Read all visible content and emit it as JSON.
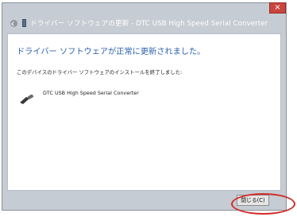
{
  "window": {
    "title": "ドライバー ソフトウェアの更新 - DTC USB High Speed Serial Converter",
    "close_glyph": "×"
  },
  "content": {
    "heading": "ドライバー ソフトウェアが正常に更新されました。",
    "description": "このデバイスのドライバー ソフトウェアのインストールを終了しました:",
    "device": {
      "icon": "usb-connector-icon",
      "name": "DTC USB High Speed Serial Converter"
    }
  },
  "footer": {
    "close_button_label": "閉じる(C)"
  },
  "colors": {
    "heading": "#2a5fad",
    "window_frame": "#c6ccd3",
    "close_button": "#c8463f",
    "highlight_annotation": "#d22a2a"
  }
}
